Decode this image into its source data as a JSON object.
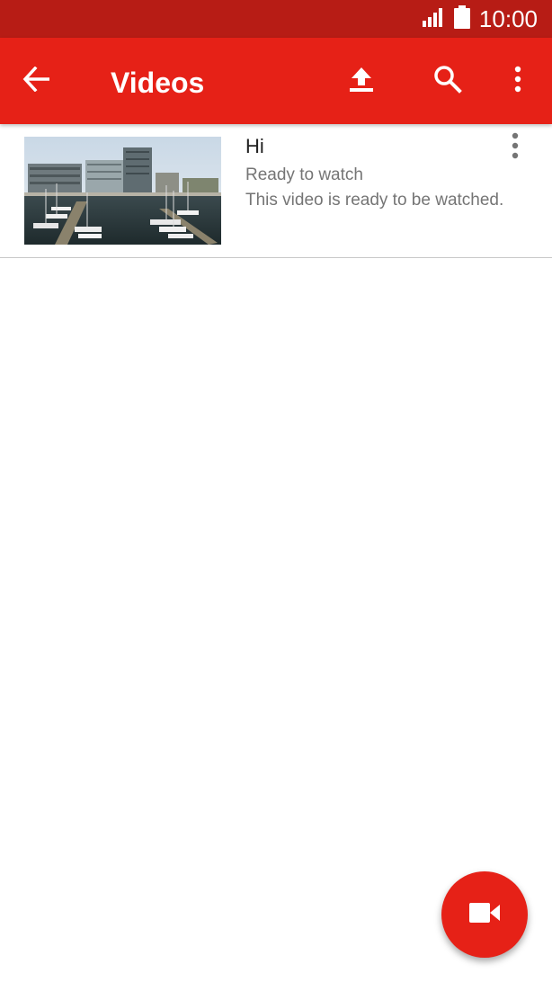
{
  "status_bar": {
    "time": "10:00"
  },
  "app_bar": {
    "title": "Videos",
    "icons": [
      "back-arrow-icon",
      "upload-icon",
      "search-icon",
      "more-vert-icon"
    ]
  },
  "videos": [
    {
      "title": "Hi",
      "status": "Ready to watch",
      "description": "This video is ready to be watched."
    }
  ],
  "fab": {
    "icon": "video-camera-icon"
  },
  "colors": {
    "status_bar": "#b71c15",
    "app_bar": "#e62117",
    "fab": "#e62117"
  }
}
